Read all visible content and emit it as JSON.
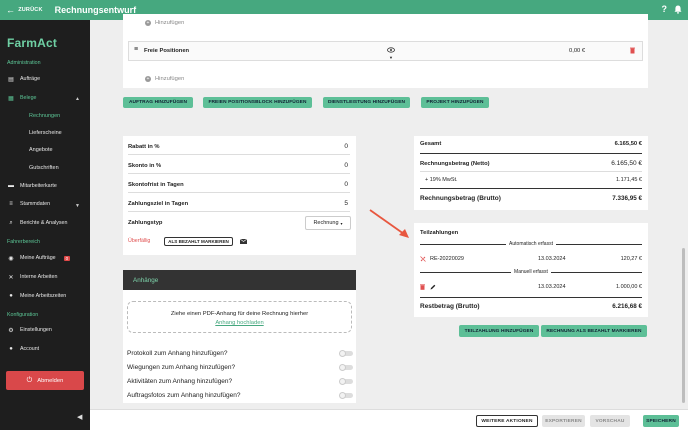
{
  "topbar": {
    "back_label": "ZURÜCK",
    "title": "Rechnungsentwurf",
    "help_icon": "?"
  },
  "sidebar": {
    "logo": "FarmAct",
    "section_admin": "Administration",
    "items": {
      "auftraege": "Aufträge",
      "belege": "Belege",
      "rechnungen": "Rechnungen",
      "lieferscheine": "Lieferscheine",
      "angebote": "Angebote",
      "gutschriften": "Gutschriften",
      "mitarbeiterkarte": "Mitarbeiterkarte",
      "stammdaten": "Stammdaten",
      "berichte": "Berichte & Analysen",
      "meine_auftraege": "Meine Aufträge",
      "meine_auftraege_badge": "0",
      "interne_arbeiten": "Interne Arbeiten",
      "meine_arbeitszeiten": "Meine Arbeitszeiten",
      "einstellungen": "Einstellungen",
      "account": "Account"
    },
    "section_fahrer": "Fahrerbereich",
    "section_config": "Konfiguration",
    "logout": "Abmelden"
  },
  "positions": {
    "add_label_top": "Hinzufügen",
    "block_title": "Freie Positionen",
    "block_amount": "0,00 €",
    "add_label": "Hinzufügen"
  },
  "actions": {
    "auftrag": "AUFTRAG HINZUFÜGEN",
    "block": "FREIEN POSITIONSBLOCK HINZUFÜGEN",
    "dienstleistung": "DIENSTLEISTUNG HINZUFÜGEN",
    "projekt": "PROJEKT HINZUFÜGEN"
  },
  "terms": {
    "rabatt_label": "Rabatt in %",
    "rabatt_value": "0",
    "skonto_label": "Skonto in %",
    "skonto_value": "0",
    "skontofrist_label": "Skontofrist in Tagen",
    "skontofrist_value": "0",
    "zahlungsziel_label": "Zahlungsziel in Tagen",
    "zahlungsziel_value": "5",
    "zahlungstyp_label": "Zahlungstyp",
    "zahlungstyp_value": "Rechnung",
    "status_badge": "Überfällig",
    "mark_paid": "ALS BEZAHLT MARKIEREN"
  },
  "attachments": {
    "header": "Anhänge",
    "drop_text": "Ziehe einen PDF-Anhang für deine Rechnung hierher",
    "upload_link": "Anhang hochladen",
    "options": [
      "Protokoll zum Anhang hinzufügen?",
      "Wiegungen zum Anhang hinzufügen?",
      "Aktivitäten zum Anhang hinzufügen?",
      "Auftragsfotos zum Anhang hinzufügen?"
    ]
  },
  "totals": {
    "gesamt_label": "Gesamt",
    "gesamt_value": "6.165,50 €",
    "netto_label": "Rechnungsbetrag (Netto)",
    "netto_value": "6.165,50 €",
    "mwst_label": "+ 19% MwSt.",
    "mwst_value": "1.171,45 €",
    "brutto_label": "Rechnungsbetrag (Brutto)",
    "brutto_value": "7.336,95 €"
  },
  "partial": {
    "title": "Teilzahlungen",
    "auto_label": "Automatisch erfasst",
    "auto_ref": "RE-20220029",
    "auto_date": "13.03.2024",
    "auto_amount": "120,27 €",
    "manual_label": "Manuell erfasst",
    "manual_date": "13.03.2024",
    "manual_amount": "1.000,00 €",
    "rest_label": "Restbetrag (Brutto)",
    "rest_value": "6.216,68 €",
    "add_btn": "TEILZAHLUNG HINZUFÜGEN",
    "paid_btn": "RECHNUNG ALS BEZAHLT MARKIEREN"
  },
  "bottom": {
    "weitere": "WEITERE AKTIONEN",
    "exportieren": "EXPORTIEREN",
    "vorschau": "VORSCHAU",
    "speichern": "SPEICHERN"
  },
  "colors": {
    "accent": "#46a87f",
    "button": "#5dbf97",
    "danger": "#d9484a",
    "sidebar": "#1e1e1e",
    "arrow": "#e8573f"
  }
}
